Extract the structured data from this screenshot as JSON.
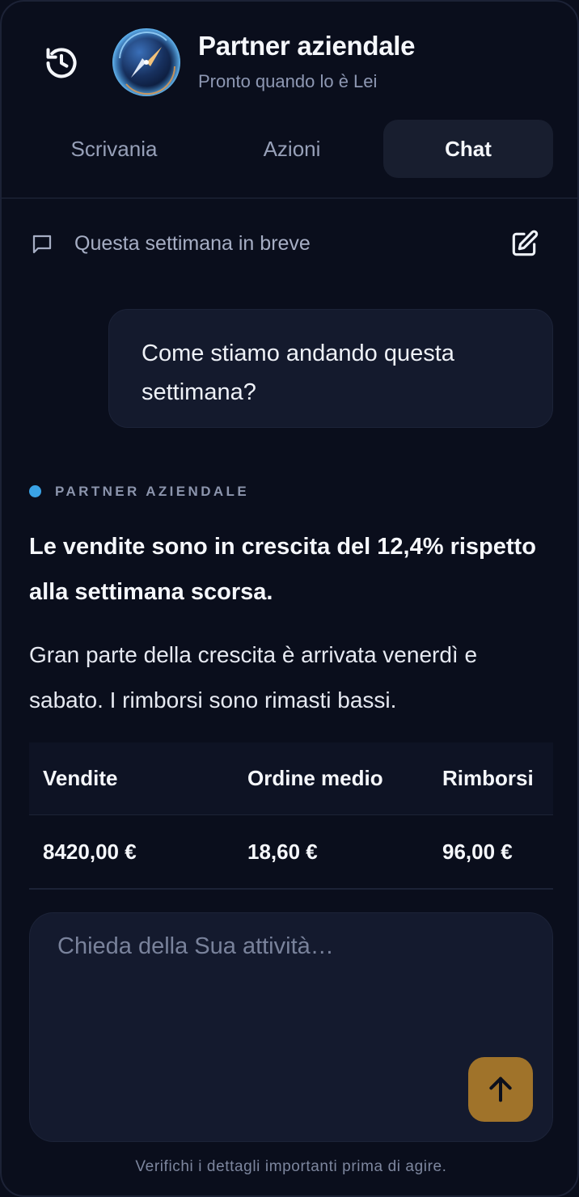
{
  "header": {
    "title": "Partner aziendale",
    "subtitle": "Pronto quando lo è Lei",
    "icons": {
      "history": "history-icon",
      "avatar": "compass-icon"
    }
  },
  "tabs": [
    {
      "label": "Scrivania",
      "active": false
    },
    {
      "label": "Azioni",
      "active": false
    },
    {
      "label": "Chat",
      "active": true
    }
  ],
  "conversation": {
    "title": "Questa settimana in breve",
    "icons": {
      "title": "chat-bubble-icon",
      "new": "edit-icon"
    }
  },
  "messages": {
    "user": "Come stiamo andando questa settimana?",
    "assistant": {
      "label": "PARTNER AZIENDALE",
      "headline": "Le vendite sono in crescita del 12,4% rispetto alla settimana scorsa.",
      "body": "Gran parte della crescita è arrivata venerdì e sabato. I rimborsi sono rimasti bassi.",
      "table": {
        "headers": [
          "Vendite",
          "Ordine medio",
          "Rimborsi"
        ],
        "rows": [
          [
            "8420,00 €",
            "18,60 €",
            "96,00 €"
          ]
        ]
      }
    }
  },
  "composer": {
    "placeholder": "Chieda della Sua attività…",
    "value": "",
    "send_icon": "arrow-up-icon"
  },
  "footer": {
    "note": "Verifichi i dettagli importanti prima di agire."
  },
  "colors": {
    "background": "#0a0e1c",
    "accent_dot": "#3aa3e6",
    "send_button": "#a0732a",
    "active_tab": "#181e2f"
  }
}
